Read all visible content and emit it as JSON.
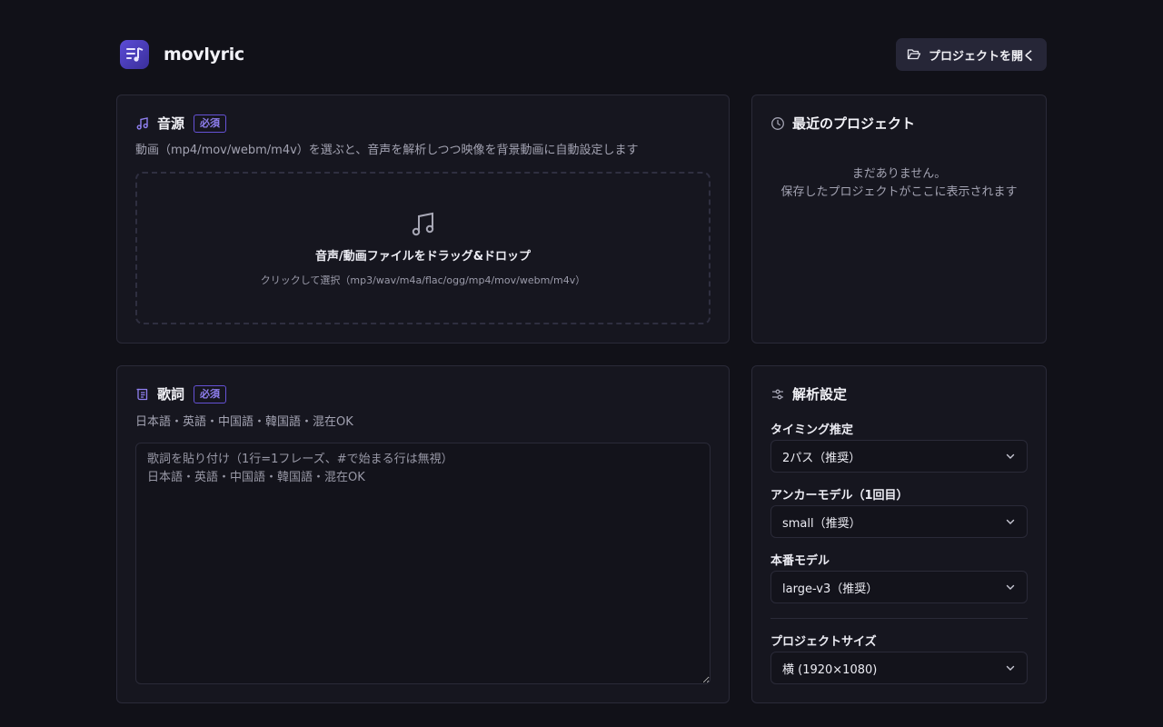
{
  "app": {
    "name": "movlyric"
  },
  "header": {
    "open_project_label": "プロジェクトを開く"
  },
  "audio_source": {
    "title": "音源",
    "badge": "必須",
    "description": "動画（mp4/mov/webm/m4v）を選ぶと、音声を解析しつつ映像を背景動画に自動設定します",
    "dropzone_title": "音声/動画ファイルをドラッグ&ドロップ",
    "dropzone_sub": "クリックして選択（mp3/wav/m4a/flac/ogg/mp4/mov/webm/m4v）"
  },
  "recent": {
    "title": "最近のプロジェクト",
    "empty_line1": "まだありません。",
    "empty_line2": "保存したプロジェクトがここに表示されます"
  },
  "lyrics": {
    "title": "歌詞",
    "badge": "必須",
    "description": "日本語・英語・中国語・韓国語・混在OK",
    "placeholder": "歌詞を貼り付け（1行=1フレーズ、#で始まる行は無視）\n日本語・英語・中国語・韓国語・混在OK",
    "value": ""
  },
  "analysis": {
    "title": "解析設定",
    "timing_label": "タイミング推定",
    "timing_value": "2パス（推奨）",
    "anchor_label": "アンカーモデル（1回目）",
    "anchor_value": "small（推奨）",
    "main_label": "本番モデル",
    "main_value": "large-v3（推奨）",
    "size_label": "プロジェクトサイズ",
    "size_value": "横 (1920×1080)"
  },
  "colors": {
    "background": "#111118",
    "card": "#16161f",
    "accent": "#7c6cf0",
    "border": "#2a2a38"
  },
  "icons": [
    "music-note-icon",
    "folder-open-icon",
    "clock-icon",
    "lyrics-scroll-icon",
    "sliders-icon",
    "chevron-down-icon"
  ]
}
